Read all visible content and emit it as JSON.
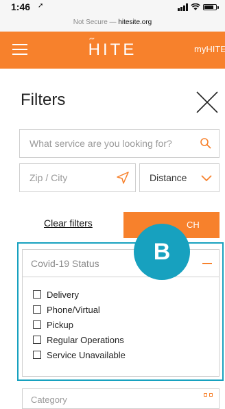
{
  "statusbar": {
    "time": "1:46"
  },
  "urlbar": {
    "prefix": "Not Secure — ",
    "host": "hitesite.org"
  },
  "header": {
    "logo": "HITE",
    "account_link": "myHITE"
  },
  "filters": {
    "title": "Filters",
    "search_placeholder": "What service are you looking for?",
    "zip_placeholder": "Zip / City",
    "distance_value": "Distance",
    "clear_label": "Clear filters",
    "search_button": "CH"
  },
  "badge": {
    "letter": "B",
    "color": "#17a1bf"
  },
  "covid": {
    "title": "Covid-19 Status",
    "options": [
      "Delivery",
      "Phone/Virtual",
      "Pickup",
      "Regular Operations",
      "Service Unavailable"
    ]
  },
  "category": {
    "title": "Category"
  },
  "colors": {
    "brand": "#f7812c",
    "highlight": "#17a1bf"
  }
}
